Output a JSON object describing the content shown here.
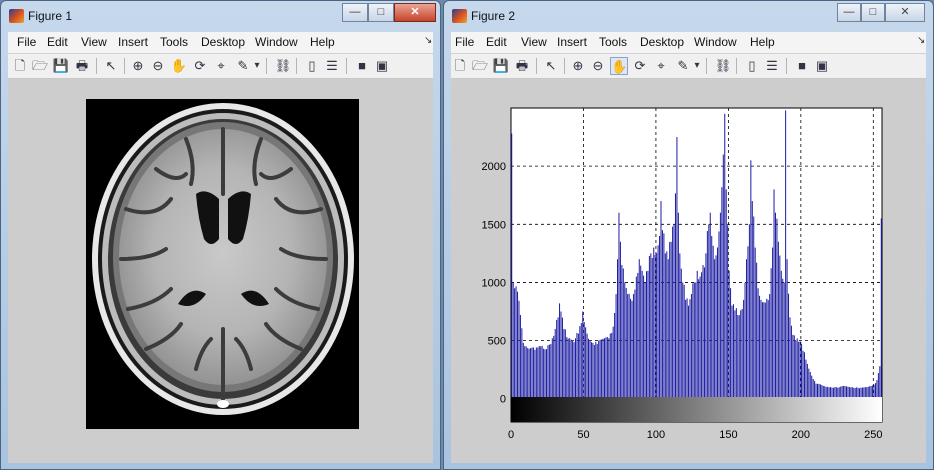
{
  "window1": {
    "title": "Figure 1",
    "controls": {
      "minimize": "—",
      "maximize": "□",
      "close": "✕"
    }
  },
  "window2": {
    "title": "Figure 2",
    "controls": {
      "minimize": "—",
      "maximize": "□",
      "close": "✕"
    }
  },
  "menu": {
    "items": [
      "File",
      "Edit",
      "View",
      "Insert",
      "Tools",
      "Desktop",
      "Window",
      "Help"
    ],
    "dock_arrow": "↘"
  },
  "toolbar": {
    "icons": [
      "new-figure-icon",
      "open-file-icon",
      "save-icon",
      "print-icon",
      "edit-plot-arrow-icon",
      "zoom-in-icon",
      "zoom-out-icon",
      "pan-hand-icon",
      "rotate-3d-icon",
      "data-cursor-icon",
      "brush-icon",
      "link-plot-icon",
      "colorbar-icon",
      "legend-icon",
      "hide-plot-tools-icon",
      "show-plot-tools-icon"
    ],
    "glyphs": {
      "new": "🗋",
      "open": "🗁",
      "save": "💾",
      "print": "🖶",
      "arrow": "↖",
      "zoom_in": "⊕",
      "zoom_out": "⊖",
      "pan": "✋",
      "rotate": "⟳",
      "cursor": "⌖",
      "brush": "✎",
      "brush_menu": "▾",
      "link": "⛓",
      "colorbar": "▯",
      "legend": "☰",
      "hide": "■",
      "show": "▣"
    }
  },
  "chart_data": {
    "type": "bar",
    "title": "",
    "xlabel": "",
    "ylabel": "",
    "xlim": [
      0,
      256
    ],
    "ylim": [
      -200,
      2500
    ],
    "xticks": [
      0,
      50,
      100,
      150,
      200,
      250
    ],
    "yticks": [
      0,
      500,
      1000,
      1500,
      2000
    ],
    "grid": true,
    "grid_style": "dashed",
    "bar_color": "#1f1fa3",
    "colorbar": {
      "from": "#000000",
      "to": "#ffffff",
      "range": [
        0,
        255
      ]
    },
    "anchors": [
      [
        0,
        2280
      ],
      [
        1,
        1000
      ],
      [
        2,
        950
      ],
      [
        4,
        920
      ],
      [
        6,
        720
      ],
      [
        8,
        480
      ],
      [
        10,
        450
      ],
      [
        12,
        430
      ],
      [
        14,
        440
      ],
      [
        16,
        420
      ],
      [
        18,
        440
      ],
      [
        20,
        450
      ],
      [
        22,
        430
      ],
      [
        25,
        460
      ],
      [
        28,
        520
      ],
      [
        30,
        600
      ],
      [
        32,
        700
      ],
      [
        33,
        820
      ],
      [
        34,
        750
      ],
      [
        36,
        600
      ],
      [
        38,
        530
      ],
      [
        40,
        520
      ],
      [
        42,
        500
      ],
      [
        44,
        520
      ],
      [
        46,
        560
      ],
      [
        48,
        650
      ],
      [
        49,
        750
      ],
      [
        50,
        660
      ],
      [
        52,
        560
      ],
      [
        54,
        500
      ],
      [
        56,
        480
      ],
      [
        58,
        490
      ],
      [
        60,
        500
      ],
      [
        62,
        510
      ],
      [
        64,
        520
      ],
      [
        66,
        530
      ],
      [
        68,
        560
      ],
      [
        70,
        620
      ],
      [
        72,
        900
      ],
      [
        73,
        1200
      ],
      [
        74,
        1600
      ],
      [
        75,
        1350
      ],
      [
        76,
        1150
      ],
      [
        78,
        1000
      ],
      [
        80,
        900
      ],
      [
        82,
        860
      ],
      [
        84,
        900
      ],
      [
        86,
        1050
      ],
      [
        88,
        1200
      ],
      [
        90,
        1100
      ],
      [
        92,
        1000
      ],
      [
        94,
        1100
      ],
      [
        96,
        1250
      ],
      [
        98,
        1300
      ],
      [
        100,
        1250
      ],
      [
        102,
        1400
      ],
      [
        103,
        1700
      ],
      [
        104,
        1450
      ],
      [
        106,
        1250
      ],
      [
        108,
        1200
      ],
      [
        110,
        1350
      ],
      [
        112,
        1500
      ],
      [
        114,
        2250
      ],
      [
        115,
        1600
      ],
      [
        116,
        1250
      ],
      [
        118,
        1000
      ],
      [
        120,
        850
      ],
      [
        122,
        800
      ],
      [
        124,
        900
      ],
      [
        126,
        1000
      ],
      [
        128,
        1100
      ],
      [
        130,
        1050
      ],
      [
        132,
        1150
      ],
      [
        134,
        1250
      ],
      [
        136,
        1500
      ],
      [
        137,
        1600
      ],
      [
        138,
        1400
      ],
      [
        140,
        1200
      ],
      [
        142,
        1300
      ],
      [
        144,
        1600
      ],
      [
        146,
        2100
      ],
      [
        147,
        2450
      ],
      [
        148,
        1800
      ],
      [
        150,
        1100
      ],
      [
        152,
        800
      ],
      [
        154,
        760
      ],
      [
        156,
        720
      ],
      [
        158,
        760
      ],
      [
        160,
        850
      ],
      [
        162,
        1200
      ],
      [
        164,
        1500
      ],
      [
        165,
        2050
      ],
      [
        166,
        1700
      ],
      [
        168,
        1300
      ],
      [
        170,
        950
      ],
      [
        172,
        850
      ],
      [
        174,
        830
      ],
      [
        176,
        860
      ],
      [
        178,
        900
      ],
      [
        180,
        1300
      ],
      [
        181,
        1800
      ],
      [
        182,
        1600
      ],
      [
        184,
        1350
      ],
      [
        186,
        1100
      ],
      [
        188,
        1000
      ],
      [
        189,
        2480
      ],
      [
        190,
        1200
      ],
      [
        192,
        700
      ],
      [
        194,
        550
      ],
      [
        196,
        500
      ],
      [
        198,
        490
      ],
      [
        200,
        470
      ],
      [
        202,
        400
      ],
      [
        204,
        300
      ],
      [
        206,
        230
      ],
      [
        208,
        170
      ],
      [
        210,
        130
      ],
      [
        215,
        110
      ],
      [
        220,
        100
      ],
      [
        225,
        95
      ],
      [
        230,
        110
      ],
      [
        235,
        100
      ],
      [
        240,
        90
      ],
      [
        245,
        100
      ],
      [
        250,
        120
      ],
      [
        252,
        160
      ],
      [
        254,
        280
      ],
      [
        255,
        1550
      ]
    ]
  },
  "colors": {
    "titlebar": "#b7cde6",
    "menubar": "#f4f4f4",
    "figure_bg": "#cdcdcd",
    "bar": "#1f1fa3"
  }
}
